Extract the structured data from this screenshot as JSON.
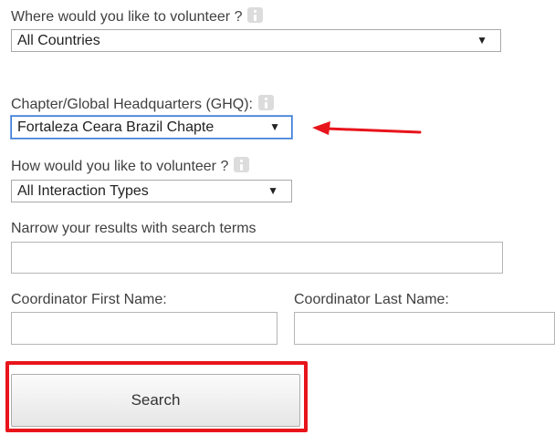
{
  "volunteer_where": {
    "label": "Where would you like to volunteer ?",
    "selected": "All Countries"
  },
  "chapter": {
    "label": "Chapter/Global Headquarters (GHQ):",
    "selected": "Fortaleza Ceara Brazil Chapte"
  },
  "volunteer_how": {
    "label": "How would you like to volunteer ?",
    "selected": "All Interaction Types"
  },
  "search_terms": {
    "label": "Narrow your results with search terms",
    "value": ""
  },
  "coordinator": {
    "first_label": "Coordinator First Name:",
    "first_value": "",
    "last_label": "Coordinator Last Name:",
    "last_value": ""
  },
  "search_button": {
    "label": "Search"
  },
  "colors": {
    "annotation_red": "#e8141b",
    "focus_blue": "#3b7bd6"
  },
  "icons": {
    "info": "info-icon",
    "dropdown": "dropdown-arrow-icon",
    "annotation": "red-arrow-annotation"
  }
}
